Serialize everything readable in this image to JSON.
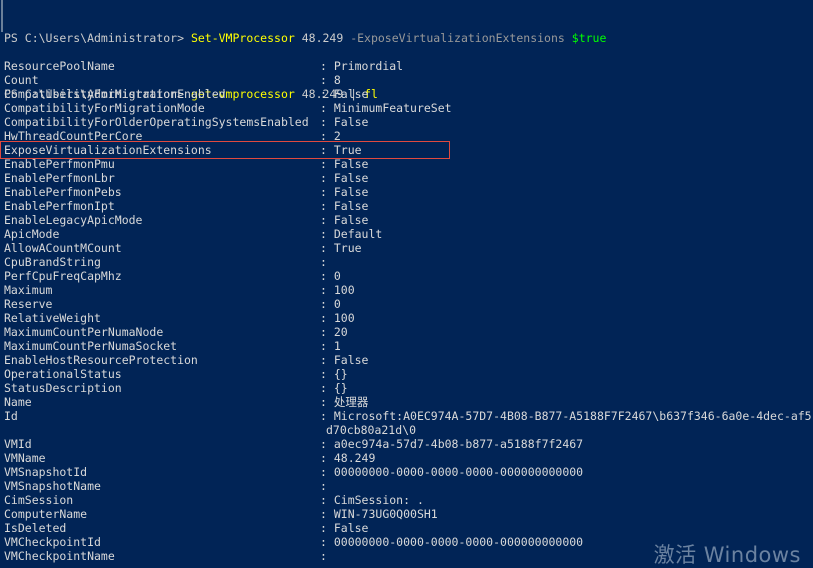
{
  "terminal": {
    "background_color": "#012456",
    "foreground_color": "#cccccc",
    "command_color": "#ffff00",
    "parameter_color": "#999999",
    "value_color": "#00ff00",
    "highlight_color": "#e04a3f"
  },
  "prompt_lines": [
    {
      "prompt": "PS C:\\Users\\Administrator> ",
      "command": "Set-VMProcessor",
      "args": " 48.249 ",
      "parameter": "-ExposeVirtualizationExtensions",
      "space": " ",
      "value": "$true"
    },
    {
      "prompt": "PS C:\\Users\\Administrator> ",
      "command": "get-vmprocessor",
      "args": " 48.249 | ",
      "parameter": "",
      "space": "",
      "value": "",
      "pipe_command": "fl"
    }
  ],
  "properties": [
    {
      "name": "ResourcePoolName",
      "value": "Primordial"
    },
    {
      "name": "Count",
      "value": "8"
    },
    {
      "name": "CompatibilityForMigrationEnabled",
      "value": "False"
    },
    {
      "name": "CompatibilityForMigrationMode",
      "value": "MinimumFeatureSet"
    },
    {
      "name": "CompatibilityForOlderOperatingSystemsEnabled",
      "value": "False"
    },
    {
      "name": "HwThreadCountPerCore",
      "value": "2"
    },
    {
      "name": "ExposeVirtualizationExtensions",
      "value": "True"
    },
    {
      "name": "EnablePerfmonPmu",
      "value": "False"
    },
    {
      "name": "EnablePerfmonLbr",
      "value": "False"
    },
    {
      "name": "EnablePerfmonPebs",
      "value": "False"
    },
    {
      "name": "EnablePerfmonIpt",
      "value": "False"
    },
    {
      "name": "EnableLegacyApicMode",
      "value": "False"
    },
    {
      "name": "ApicMode",
      "value": "Default"
    },
    {
      "name": "AllowACountMCount",
      "value": "True"
    },
    {
      "name": "CpuBrandString",
      "value": ""
    },
    {
      "name": "PerfCpuFreqCapMhz",
      "value": "0"
    },
    {
      "name": "Maximum",
      "value": "100"
    },
    {
      "name": "Reserve",
      "value": "0"
    },
    {
      "name": "RelativeWeight",
      "value": "100"
    },
    {
      "name": "MaximumCountPerNumaNode",
      "value": "20"
    },
    {
      "name": "MaximumCountPerNumaSocket",
      "value": "1"
    },
    {
      "name": "EnableHostResourceProtection",
      "value": "False"
    },
    {
      "name": "OperationalStatus",
      "value": "{}"
    },
    {
      "name": "StatusDescription",
      "value": "{}"
    },
    {
      "name": "Name",
      "value": "处理器"
    },
    {
      "name": "Id",
      "value": "Microsoft:A0EC974A-57D7-4B08-B877-A5188F7F2467\\b637f346-6a0e-4dec-af5",
      "continuation": "d70cb80a21d\\0"
    },
    {
      "name": "VMId",
      "value": "a0ec974a-57d7-4b08-b877-a5188f7f2467"
    },
    {
      "name": "VMName",
      "value": "48.249"
    },
    {
      "name": "VMSnapshotId",
      "value": "00000000-0000-0000-0000-000000000000"
    },
    {
      "name": "VMSnapshotName",
      "value": ""
    },
    {
      "name": "CimSession",
      "value": "CimSession: ."
    },
    {
      "name": "ComputerName",
      "value": "WIN-73UG0Q00SH1"
    },
    {
      "name": "IsDeleted",
      "value": "False"
    },
    {
      "name": "VMCheckpointId",
      "value": "00000000-0000-0000-0000-000000000000"
    },
    {
      "name": "VMCheckpointName",
      "value": ""
    }
  ],
  "highlight": {
    "property_name": "ExposeVirtualizationExtensions",
    "row_index": 6
  },
  "watermark": {
    "line1": "激活 Windows"
  }
}
